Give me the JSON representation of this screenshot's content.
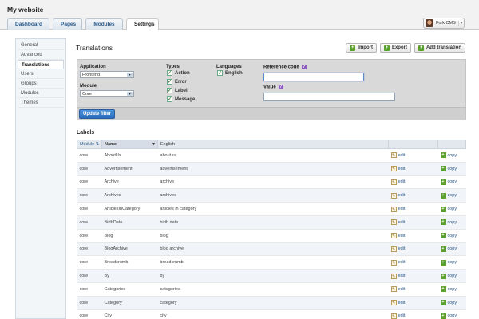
{
  "site": {
    "title": "My website"
  },
  "tabs": [
    {
      "label": "Dashboard"
    },
    {
      "label": "Pages"
    },
    {
      "label": "Modules"
    },
    {
      "label": "Settings",
      "active": true
    }
  ],
  "user": {
    "name": "Fork CMS",
    "caret": "▾"
  },
  "sidebar": {
    "items": [
      {
        "label": "General"
      },
      {
        "label": "Advanced"
      },
      {
        "label": "Translations",
        "active": true
      },
      {
        "label": "Users"
      },
      {
        "label": "Groups"
      },
      {
        "label": "Modules"
      },
      {
        "label": "Themes"
      }
    ]
  },
  "main": {
    "title": "Translations",
    "buttons": {
      "import": "Import",
      "export": "Export",
      "add": "Add translation",
      "plus": "+"
    }
  },
  "filter": {
    "application_label": "Application",
    "application_value": "Frontend",
    "module_label": "Module",
    "module_value": "Core",
    "types_label": "Types",
    "types": [
      "Action",
      "Error",
      "Label",
      "Message"
    ],
    "languages_label": "Languages",
    "languages": [
      "English"
    ],
    "reference_label": "Reference code",
    "reference_value": "",
    "value_label": "Value",
    "value_value": "",
    "help": "?",
    "check": "✓",
    "update_button": "Update filter"
  },
  "labels": {
    "title": "Labels",
    "columns": {
      "module": "Module",
      "name": "Name",
      "english": "English",
      "sort_asc": "⇅",
      "sort_down": "▾"
    },
    "edit_label": "edit",
    "copy_label": "copy",
    "rows": [
      {
        "module": "core",
        "name": "AboutUs",
        "english": "about us"
      },
      {
        "module": "core",
        "name": "Advertisement",
        "english": "advertisement"
      },
      {
        "module": "core",
        "name": "Archive",
        "english": "archive"
      },
      {
        "module": "core",
        "name": "Archives",
        "english": "archives"
      },
      {
        "module": "core",
        "name": "ArticlesInCategory",
        "english": "articles in category"
      },
      {
        "module": "core",
        "name": "BirthDate",
        "english": "birth date"
      },
      {
        "module": "core",
        "name": "Blog",
        "english": "blog"
      },
      {
        "module": "core",
        "name": "BlogArchive",
        "english": "blog archive"
      },
      {
        "module": "core",
        "name": "Breadcrumb",
        "english": "breadcrumb"
      },
      {
        "module": "core",
        "name": "By",
        "english": "by"
      },
      {
        "module": "core",
        "name": "Categories",
        "english": "categories"
      },
      {
        "module": "core",
        "name": "Category",
        "english": "category"
      },
      {
        "module": "core",
        "name": "City",
        "english": "city"
      }
    ]
  }
}
